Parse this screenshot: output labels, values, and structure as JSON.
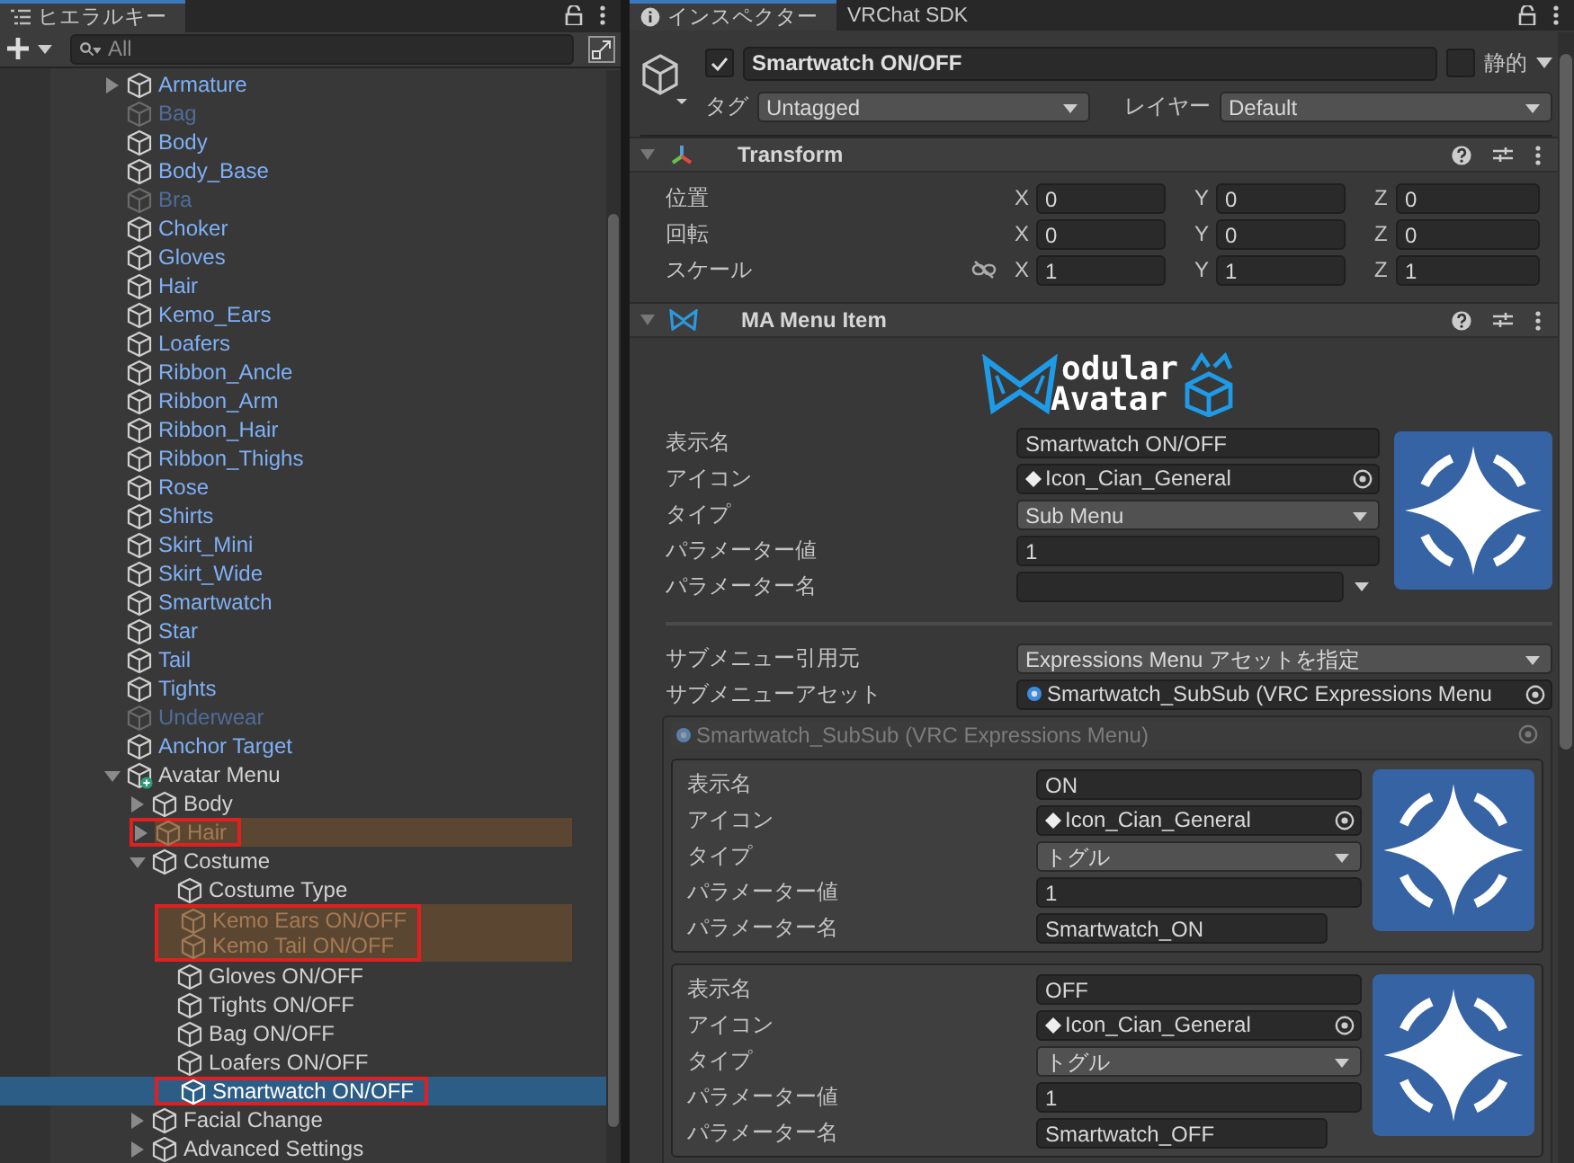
{
  "hierarchy": {
    "tab": {
      "title": "ヒエラルキー",
      "selected": true
    },
    "search": {
      "placeholder": "All"
    },
    "items": [
      {
        "label": "Armature",
        "kind": "prefab",
        "active": true,
        "expanded": false,
        "selected": false,
        "highlighted": false,
        "boxed": false
      },
      {
        "label": "Bag",
        "kind": "prefab",
        "active": false,
        "selected": false,
        "highlighted": false,
        "boxed": false
      },
      {
        "label": "Body",
        "kind": "prefab",
        "active": true,
        "selected": false,
        "highlighted": false,
        "boxed": false
      },
      {
        "label": "Body_Base",
        "kind": "prefab",
        "active": true,
        "selected": false,
        "highlighted": false,
        "boxed": false
      },
      {
        "label": "Bra",
        "kind": "prefab",
        "active": false,
        "selected": false,
        "highlighted": false,
        "boxed": false
      },
      {
        "label": "Choker",
        "kind": "prefab",
        "active": true,
        "selected": false,
        "highlighted": false,
        "boxed": false
      },
      {
        "label": "Gloves",
        "kind": "prefab",
        "active": true,
        "selected": false,
        "highlighted": false,
        "boxed": false
      },
      {
        "label": "Hair",
        "kind": "prefab",
        "active": true,
        "selected": false,
        "highlighted": false,
        "boxed": false
      },
      {
        "label": "Kemo_Ears",
        "kind": "prefab",
        "active": true,
        "selected": false,
        "highlighted": false,
        "boxed": false
      },
      {
        "label": "Loafers",
        "kind": "prefab",
        "active": true,
        "selected": false,
        "highlighted": false,
        "boxed": false
      },
      {
        "label": "Ribbon_Ancle",
        "kind": "prefab",
        "active": true,
        "selected": false,
        "highlighted": false,
        "boxed": false
      },
      {
        "label": "Ribbon_Arm",
        "kind": "prefab",
        "active": true,
        "selected": false,
        "highlighted": false,
        "boxed": false
      },
      {
        "label": "Ribbon_Hair",
        "kind": "prefab",
        "active": true,
        "selected": false,
        "highlighted": false,
        "boxed": false
      },
      {
        "label": "Ribbon_Thighs",
        "kind": "prefab",
        "active": true,
        "selected": false,
        "highlighted": false,
        "boxed": false
      },
      {
        "label": "Rose",
        "kind": "prefab",
        "active": true,
        "selected": false,
        "highlighted": false,
        "boxed": false
      },
      {
        "label": "Shirts",
        "kind": "prefab",
        "active": true,
        "selected": false,
        "highlighted": false,
        "boxed": false
      },
      {
        "label": "Skirt_Mini",
        "kind": "prefab",
        "active": true,
        "selected": false,
        "highlighted": false,
        "boxed": false
      },
      {
        "label": "Skirt_Wide",
        "kind": "prefab",
        "active": true,
        "selected": false,
        "highlighted": false,
        "boxed": false
      },
      {
        "label": "Smartwatch",
        "kind": "prefab",
        "active": true,
        "selected": false,
        "highlighted": false,
        "boxed": false
      },
      {
        "label": "Star",
        "kind": "prefab",
        "active": true,
        "selected": false,
        "highlighted": false,
        "boxed": false
      },
      {
        "label": "Tail",
        "kind": "prefab",
        "active": true,
        "selected": false,
        "highlighted": false,
        "boxed": false
      },
      {
        "label": "Tights",
        "kind": "prefab",
        "active": true,
        "selected": false,
        "highlighted": false,
        "boxed": false
      },
      {
        "label": "Underwear",
        "kind": "prefab",
        "active": false,
        "selected": false,
        "highlighted": false,
        "boxed": false
      },
      {
        "label": "Anchor Target",
        "kind": "prefab",
        "active": true,
        "selected": false,
        "highlighted": false,
        "boxed": false
      },
      {
        "label": "Avatar Menu",
        "kind": "added",
        "active": true,
        "expanded": true,
        "selected": false,
        "highlighted": false,
        "boxed": false,
        "children": [
          {
            "label": "Body",
            "kind": "object",
            "active": true,
            "expanded": false,
            "selected": false,
            "highlighted": false,
            "boxed": false
          },
          {
            "label": "Hair",
            "kind": "object",
            "active": true,
            "expanded": false,
            "selected": false,
            "highlighted": true,
            "boxed": true
          },
          {
            "label": "Costume",
            "kind": "object",
            "active": true,
            "expanded": true,
            "selected": false,
            "highlighted": false,
            "boxed": false,
            "children": [
              {
                "label": "Costume Type",
                "kind": "object",
                "active": true,
                "selected": false,
                "highlighted": false,
                "boxed": false
              },
              {
                "label": "Kemo Ears ON/OFF",
                "kind": "object",
                "active": true,
                "selected": false,
                "highlighted": true,
                "boxed": true
              },
              {
                "label": "Kemo Tail ON/OFF",
                "kind": "object",
                "active": true,
                "selected": false,
                "highlighted": true,
                "boxed": true
              },
              {
                "label": "Gloves ON/OFF",
                "kind": "object",
                "active": true,
                "selected": false,
                "highlighted": false,
                "boxed": false
              },
              {
                "label": "Tights ON/OFF",
                "kind": "object",
                "active": true,
                "selected": false,
                "highlighted": false,
                "boxed": false
              },
              {
                "label": "Bag ON/OFF",
                "kind": "object",
                "active": true,
                "selected": false,
                "highlighted": false,
                "boxed": false
              },
              {
                "label": "Loafers ON/OFF",
                "kind": "object",
                "active": true,
                "selected": false,
                "highlighted": false,
                "boxed": false
              },
              {
                "label": "Smartwatch ON/OFF",
                "kind": "object",
                "active": true,
                "selected": true,
                "highlighted": false,
                "boxed": true
              }
            ]
          },
          {
            "label": "Facial Change",
            "kind": "object",
            "active": true,
            "expanded": false,
            "selected": false,
            "highlighted": false,
            "boxed": false
          },
          {
            "label": "Advanced Settings",
            "kind": "object",
            "active": true,
            "expanded": false,
            "selected": false,
            "highlighted": false,
            "boxed": false
          }
        ]
      }
    ]
  },
  "inspector": {
    "tabs": [
      {
        "label": "インスペクター",
        "selected": true
      },
      {
        "label": "VRChat SDK",
        "selected": false
      }
    ],
    "object": {
      "active": true,
      "name": "Smartwatch ON/OFF",
      "static": false,
      "static_label": "静的",
      "tag_label": "タグ",
      "tag": "Untagged",
      "layer_label": "レイヤー",
      "layer": "Default"
    },
    "transform": {
      "title": "Transform",
      "expanded": true,
      "rows": [
        {
          "label": "位置",
          "values": [
            {
              "axis": "X",
              "value": "0"
            },
            {
              "axis": "Y",
              "value": "0"
            },
            {
              "axis": "Z",
              "value": "0"
            }
          ]
        },
        {
          "label": "回転",
          "values": [
            {
              "axis": "X",
              "value": "0"
            },
            {
              "axis": "Y",
              "value": "0"
            },
            {
              "axis": "Z",
              "value": "0"
            }
          ]
        },
        {
          "label": "スケール",
          "proportional": false,
          "values": [
            {
              "axis": "X",
              "value": "1"
            },
            {
              "axis": "Y",
              "value": "1"
            },
            {
              "axis": "Z",
              "value": "1"
            }
          ]
        }
      ]
    },
    "menu_item": {
      "title": "MA Menu Item",
      "expanded": true,
      "logo": [
        "odular",
        "Avatar"
      ],
      "fields": [
        {
          "kind": "text",
          "label": "表示名",
          "value": "Smartwatch ON/OFF"
        },
        {
          "kind": "object",
          "label": "アイコン",
          "value": "Icon_Cian_General"
        },
        {
          "kind": "dropdown",
          "label": "タイプ",
          "value": "Sub Menu"
        },
        {
          "kind": "text",
          "label": "パラメーター値",
          "value": "1"
        },
        {
          "kind": "param",
          "label": "パラメーター名"
        }
      ],
      "submenu_fields": [
        {
          "kind": "dropdown",
          "label": "サブメニュー引用元",
          "value": "Expressions Menu アセットを指定"
        },
        {
          "kind": "object",
          "label": "サブメニューアセット",
          "value": "Smartwatch_SubSub (VRC Expressions Menu"
        }
      ],
      "submenu": {
        "title": "Smartwatch_SubSub (VRC Expressions Menu)",
        "disabled": true,
        "controls": [
          {
            "fields": [
              {
                "kind": "text",
                "label": "表示名",
                "value": "ON"
              },
              {
                "kind": "object",
                "label": "アイコン",
                "value": "Icon_Cian_General"
              },
              {
                "kind": "dropdown",
                "label": "タイプ",
                "value": "トグル"
              },
              {
                "kind": "text",
                "label": "パラメーター値",
                "value": "1"
              },
              {
                "kind": "short",
                "label": "パラメーター名",
                "value": "Smartwatch_ON"
              }
            ]
          },
          {
            "fields": [
              {
                "kind": "text",
                "label": "表示名",
                "value": "OFF"
              },
              {
                "kind": "object",
                "label": "アイコン",
                "value": "Icon_Cian_General"
              },
              {
                "kind": "dropdown",
                "label": "タイプ",
                "value": "トグル"
              },
              {
                "kind": "text",
                "label": "パラメーター値",
                "value": "1"
              },
              {
                "kind": "short",
                "label": "パラメーター名",
                "value": "Smartwatch_OFF"
              }
            ]
          }
        ]
      }
    }
  }
}
